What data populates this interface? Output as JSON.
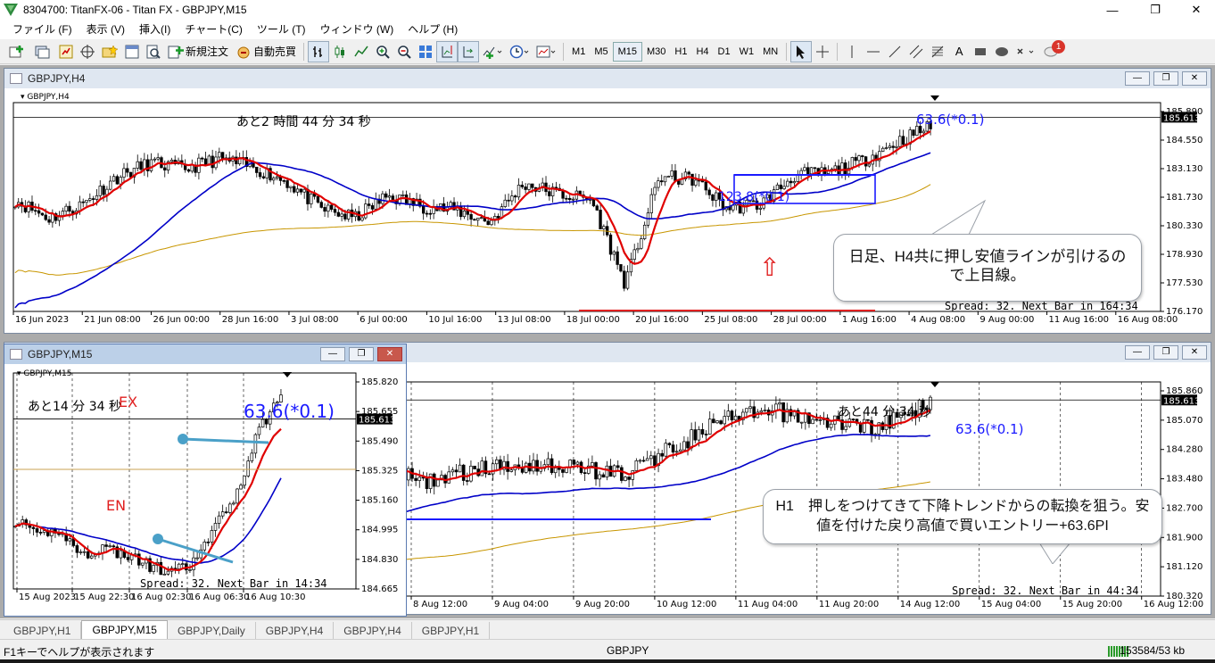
{
  "app": {
    "title": "8304700: TitanFX-06 - Titan FX - GBPJPY,M15"
  },
  "menu": [
    "ファイル (F)",
    "表示 (V)",
    "挿入(I)",
    "チャート(C)",
    "ツール (T)",
    "ウィンドウ (W)",
    "ヘルプ (H)"
  ],
  "toolbar": {
    "new_order": "新規注文",
    "auto_trade": "自動売買",
    "timeframes": [
      "M1",
      "M5",
      "M15",
      "M30",
      "H1",
      "H4",
      "D1",
      "W1",
      "MN"
    ],
    "active_timeframe": "M15",
    "text_tool": "A",
    "notification_count": "1"
  },
  "colors": {
    "ma_fast": "#e00000",
    "ma_mid": "#0000c8",
    "ma_slow": "#c89600",
    "annotation": "#1a1aff",
    "arrow": "#e02020",
    "pointer": "#4aa0c8",
    "price_tag": "#000000"
  },
  "win_h4": {
    "caption": "GBPJPY,H4",
    "symbol": "GBPJPY,H4",
    "countdown": "あと2 時間  44 分  34 秒",
    "fib_label_top": "63.6(*0.1)",
    "fib_label_mid": "123.8(*0.1)",
    "spread_text": "Spread: 32. Next Bar in 164:34",
    "current_price": "185.613",
    "price_ticks": [
      "185.890",
      "184.550",
      "183.130",
      "181.730",
      "180.330",
      "178.930",
      "177.530",
      "176.170"
    ],
    "time_ticks": [
      "16 Jun 2023",
      "21 Jun 08:00",
      "26 Jun 00:00",
      "28 Jun 16:00",
      "3 Jul 08:00",
      "6 Jul 00:00",
      "10 Jul 16:00",
      "13 Jul 08:00",
      "18 Jul 00:00",
      "20 Jul 16:00",
      "25 Jul 08:00",
      "28 Jul 00:00",
      "1 Aug 16:00",
      "4 Aug 08:00",
      "9 Aug 00:00",
      "11 Aug 16:00",
      "16 Aug 08:00"
    ],
    "callout": "日足、H4共に押し安値ラインが引けるので上目線。",
    "up_arrow": "⇧"
  },
  "win_h1": {
    "countdown": "あと44 分  34 秒",
    "fib_label": "63.6(*0.1)",
    "spread_text": "Spread: 32. Next Bar in 44:34",
    "current_price": "185.613",
    "price_ticks": [
      "185.860",
      "185.070",
      "184.280",
      "183.480",
      "182.700",
      "181.900",
      "181.120",
      "180.320"
    ],
    "time_ticks": [
      "8 Aug 12:00",
      "9 Aug 04:00",
      "9 Aug 20:00",
      "10 Aug 12:00",
      "11 Aug 04:00",
      "11 Aug 20:00",
      "14 Aug 12:00",
      "15 Aug 04:00",
      "15 Aug 20:00",
      "16 Aug 12:00"
    ],
    "callout": "H1　押しをつけてきて下降トレンドからの転換を狙う。安値を付けた戻り高値で買いエントリー+63.6PI"
  },
  "win_m15": {
    "caption": "GBPJPY,M15",
    "symbol": "GBPJPY,M15",
    "countdown": "あと14 分  34 秒",
    "fib_label": "63.6(*0.1)",
    "spread_text": "Spread: 32. Next Bar in 14:34",
    "current_price": "185.613",
    "ex_label": "EX",
    "en_label": "EN",
    "price_ticks": [
      "185.820",
      "185.655",
      "185.490",
      "185.325",
      "185.160",
      "184.995",
      "184.830",
      "184.665"
    ],
    "time_ticks": [
      "15 Aug 2023",
      "15 Aug 22:30",
      "16 Aug 02:30",
      "16 Aug 06:30",
      "16 Aug 10:30"
    ]
  },
  "tabs": [
    "GBPJPY,H1",
    "GBPJPY,M15",
    "GBPJPY,Daily",
    "GBPJPY,H4",
    "GBPJPY,H4",
    "GBPJPY,H1"
  ],
  "active_tab": 1,
  "status": {
    "help": "F1キーでヘルプが表示されます",
    "symbol": "GBPJPY",
    "traffic": "153584/53 kb"
  }
}
